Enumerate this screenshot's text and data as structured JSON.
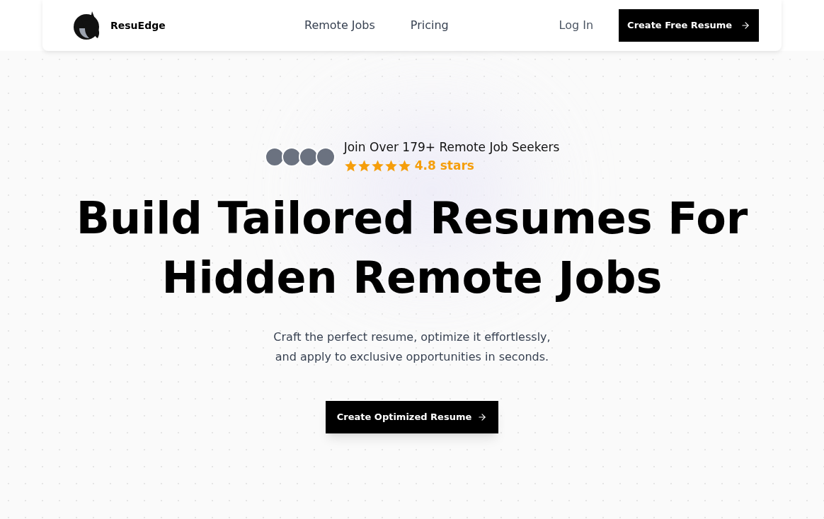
{
  "brand": {
    "name": "ResuEdge"
  },
  "nav": {
    "links": [
      "Remote Jobs",
      "Pricing"
    ],
    "login": "Log In",
    "cta": "Create Free Resume"
  },
  "hero": {
    "social_proof": "Join Over 179+ Remote Job Seekers",
    "stars": 5,
    "rating": "4.8 stars",
    "title_lines": [
      "Build Tailored Resumes For",
      "Hidden Remote Jobs"
    ],
    "subtitle_lines": [
      "Craft the perfect resume, optimize it effortlessly,",
      "and apply to exclusive opportunities in seconds."
    ],
    "cta": "Create Optimized Resume"
  }
}
